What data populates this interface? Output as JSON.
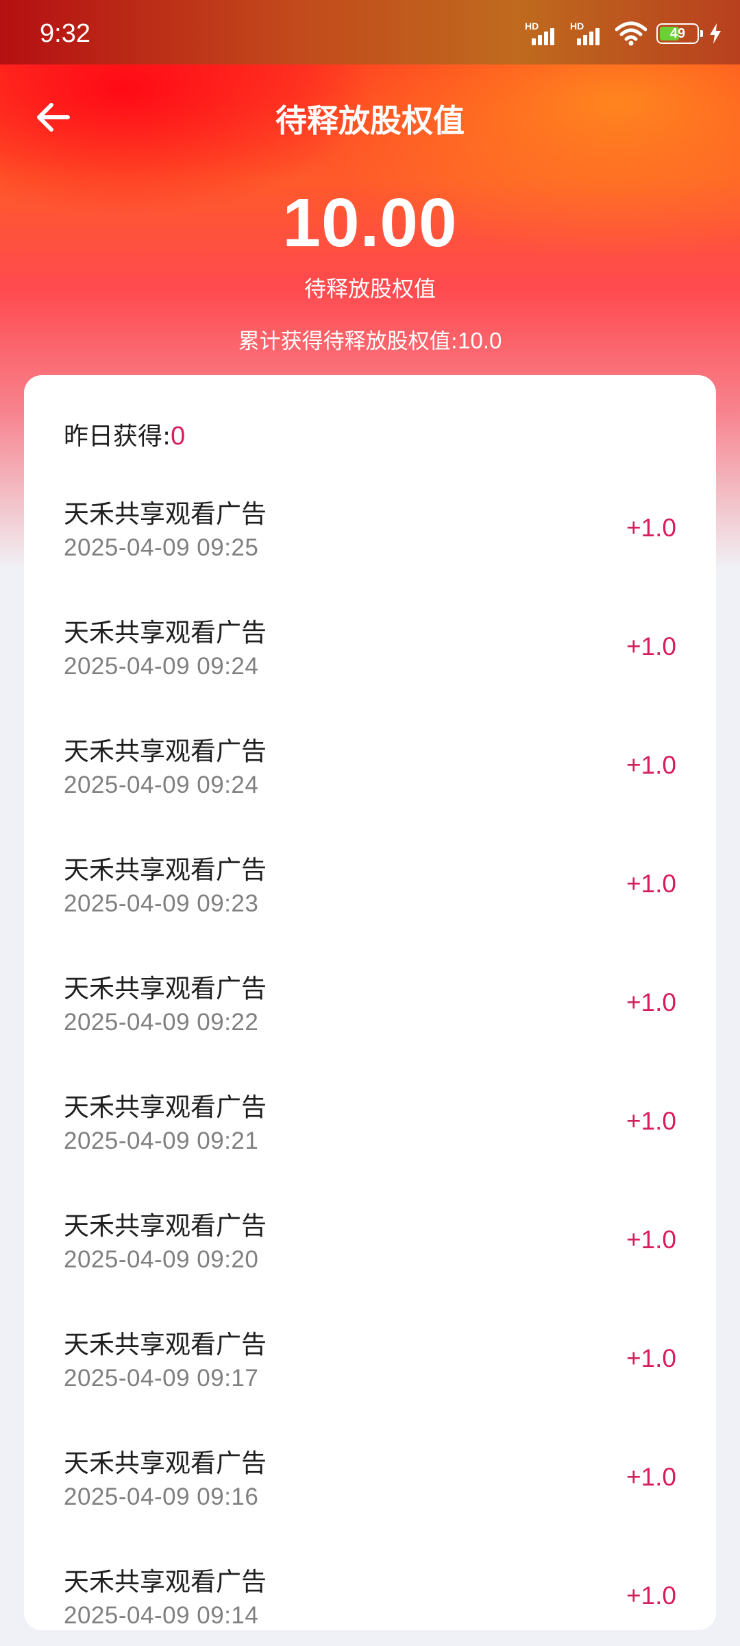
{
  "status_bar": {
    "time": "9:32",
    "battery": "49",
    "signal_hd_label": "HD",
    "icons": [
      "signal-icon",
      "signal-icon",
      "wifi-icon",
      "battery-icon",
      "charging-icon"
    ]
  },
  "header": {
    "title": "待释放股权值",
    "back_icon": "arrow-left-icon"
  },
  "summary": {
    "amount": "10.00",
    "amount_label": "待释放股权值",
    "total_label": "累计获得待释放股权值:",
    "total_value": "10.0"
  },
  "card": {
    "yesterday_label": "昨日获得:",
    "yesterday_value": "0"
  },
  "records": [
    {
      "title": "天禾共享观看广告",
      "time": "2025-04-09 09:25",
      "amount": "+1.0"
    },
    {
      "title": "天禾共享观看广告",
      "time": "2025-04-09 09:24",
      "amount": "+1.0"
    },
    {
      "title": "天禾共享观看广告",
      "time": "2025-04-09 09:24",
      "amount": "+1.0"
    },
    {
      "title": "天禾共享观看广告",
      "time": "2025-04-09 09:23",
      "amount": "+1.0"
    },
    {
      "title": "天禾共享观看广告",
      "time": "2025-04-09 09:22",
      "amount": "+1.0"
    },
    {
      "title": "天禾共享观看广告",
      "time": "2025-04-09 09:21",
      "amount": "+1.0"
    },
    {
      "title": "天禾共享观看广告",
      "time": "2025-04-09 09:20",
      "amount": "+1.0"
    },
    {
      "title": "天禾共享观看广告",
      "time": "2025-04-09 09:17",
      "amount": "+1.0"
    },
    {
      "title": "天禾共享观看广告",
      "time": "2025-04-09 09:16",
      "amount": "+1.0"
    },
    {
      "title": "天禾共享观看广告",
      "time": "2025-04-09 09:14",
      "amount": "+1.0"
    }
  ],
  "colors": {
    "accent": "#d61f5a",
    "header_red": "#ff2a1e",
    "header_orange": "#ff8c1e"
  }
}
